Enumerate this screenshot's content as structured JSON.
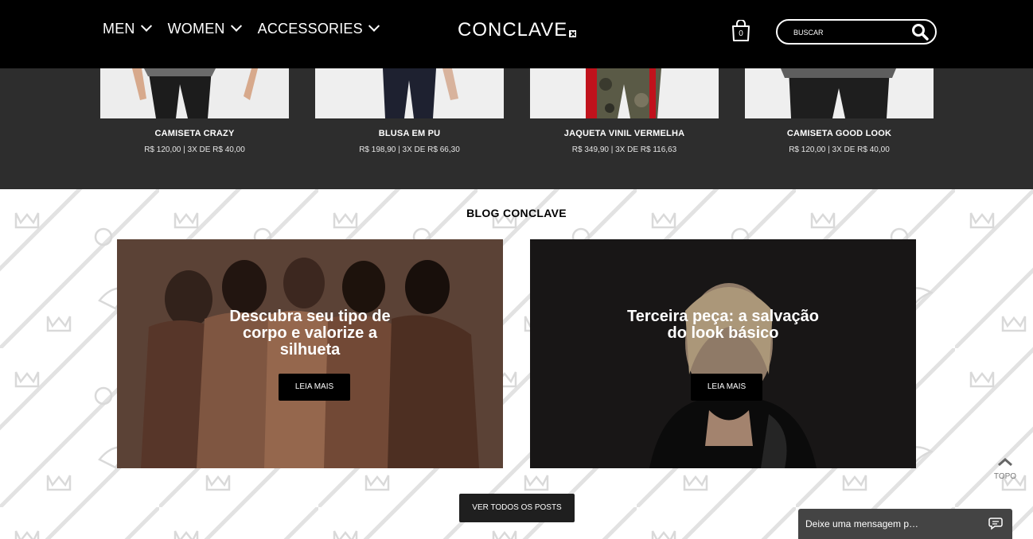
{
  "header": {
    "nav": [
      {
        "label": "MEN"
      },
      {
        "label": "WOMEN"
      },
      {
        "label": "ACCESSORIES"
      }
    ],
    "logo_text": "CONCLAVE",
    "cart_count": "0",
    "search_placeholder": "BUSCAR"
  },
  "products": [
    {
      "name": "CAMISETA CRAZY",
      "price": "R$ 120,00 | 3X DE R$ 40,00"
    },
    {
      "name": "BLUSA EM PU",
      "price": "R$ 198,90 | 3X DE R$ 66,30"
    },
    {
      "name": "JAQUETA VINIL VERMELHA",
      "price": "R$ 349,90 | 3X DE R$ 116,63"
    },
    {
      "name": "CAMISETA GOOD LOOK",
      "price": "R$ 120,00 | 3X DE R$ 40,00"
    }
  ],
  "blog": {
    "title": "BLOG CONCLAVE",
    "posts": [
      {
        "title_lines": [
          "Descubra seu tipo de",
          "corpo e valorize a",
          "silhueta"
        ],
        "button": "LEIA MAIS"
      },
      {
        "title_lines": [
          "Terceira peça: a salvação",
          "do look básico"
        ],
        "button": "LEIA MAIS"
      }
    ],
    "all_posts_button": "VER TODOS OS POSTS"
  },
  "topo_label": "TOPO",
  "chat_label": "Deixe uma mensagem p…",
  "colors": {
    "header_bg": "#000000",
    "strip_bg": "#2d2d2d",
    "button_bg": "#000000",
    "chat_bg": "#444444"
  }
}
